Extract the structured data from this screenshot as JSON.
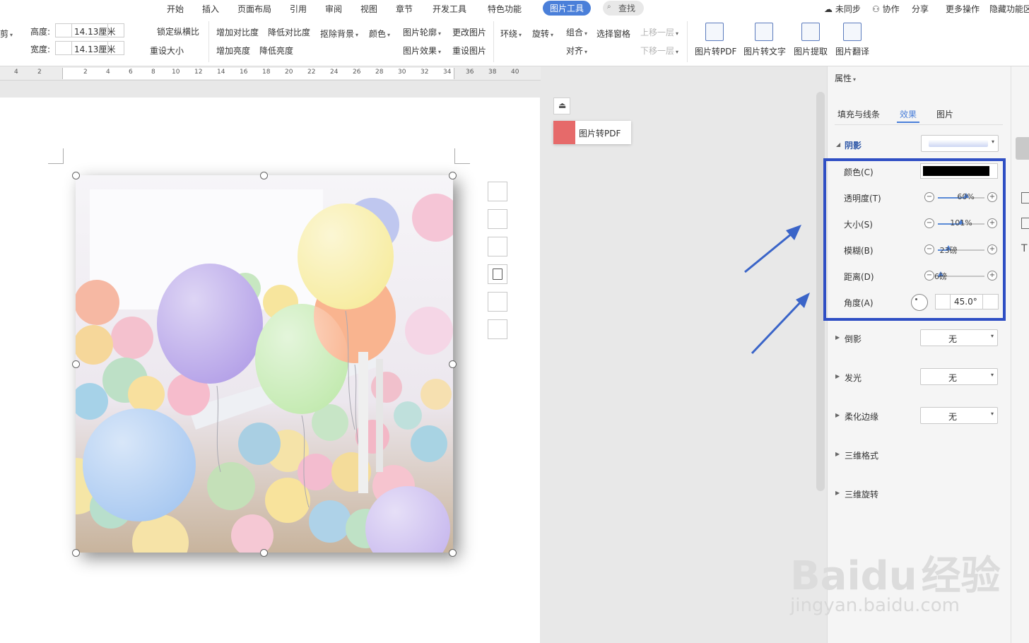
{
  "ribbon_tabs": [
    "开始",
    "插入",
    "页面布局",
    "引用",
    "审阅",
    "视图",
    "章节",
    "开发工具",
    "特色功能",
    "图片工具",
    "查找"
  ],
  "ribbon_right": {
    "unsync": "未同步",
    "collab": "协作",
    "share": "分享",
    "more": "更多操作",
    "hide": "隐藏功能区"
  },
  "toolbar": {
    "cut": "剪",
    "height_label": "高度:",
    "height_value": "14.13厘米",
    "width_label": "宽度:",
    "width_value": "14.13厘米",
    "lock_ratio": "锁定纵横比",
    "reset_size": "重设大小",
    "inc_contrast": "增加对比度",
    "dec_contrast": "降低对比度",
    "remove_bg": "抠除背景",
    "color": "颜色",
    "inc_brightness": "增加亮度",
    "dec_brightness": "降低亮度",
    "outline": "图片轮廓",
    "change_pic": "更改图片",
    "effects": "图片效果",
    "reset_pic": "重设图片",
    "wrap": "环绕",
    "rotate": "旋转",
    "group": "组合",
    "selection_pane": "选择窗格",
    "bring_forward": "上移一层",
    "align": "对齐",
    "send_backward": "下移一层",
    "to_pdf": "图片转PDF",
    "to_text": "图片转文字",
    "extract": "图片提取",
    "translate": "图片翻译"
  },
  "ruler_ticks": [
    "4",
    "2",
    "2",
    "4",
    "6",
    "8",
    "10",
    "12",
    "14",
    "16",
    "18",
    "20",
    "22",
    "24",
    "26",
    "28",
    "30",
    "32",
    "34",
    "36",
    "38",
    "40"
  ],
  "float_bar": {
    "to_pdf_label": "图片转PDF"
  },
  "panel": {
    "title": "属性",
    "tabs": [
      "填充与线条",
      "效果",
      "图片"
    ],
    "active_tab": "效果",
    "shadow": {
      "label": "阴影",
      "color_label": "颜色(C)",
      "color_value": "#000000",
      "transparency_label": "透明度(T)",
      "transparency": "60%",
      "transparency_pct": 60,
      "size_label": "大小(S)",
      "size": "101%",
      "size_pct": 50,
      "blur_label": "模糊(B)",
      "blur": "23磅",
      "blur_pct": 23,
      "distance_label": "距离(D)",
      "distance": "6磅",
      "distance_pct": 6,
      "angle_label": "角度(A)",
      "angle": "45.0°"
    },
    "reflection": {
      "label": "倒影",
      "value": "无"
    },
    "glow": {
      "label": "发光",
      "value": "无"
    },
    "soft_edges": {
      "label": "柔化边缘",
      "value": "无"
    },
    "format_3d": {
      "label": "三维格式"
    },
    "rotation_3d": {
      "label": "三维旋转"
    }
  },
  "watermark": {
    "brand": "Bai",
    "brand2": "du",
    "cn": "经验",
    "url": "jingyan.baidu.com"
  },
  "colors": {
    "accent": "#4a7fd9",
    "highlight_box": "#2f4fc4",
    "arrow": "#3a64c8"
  }
}
